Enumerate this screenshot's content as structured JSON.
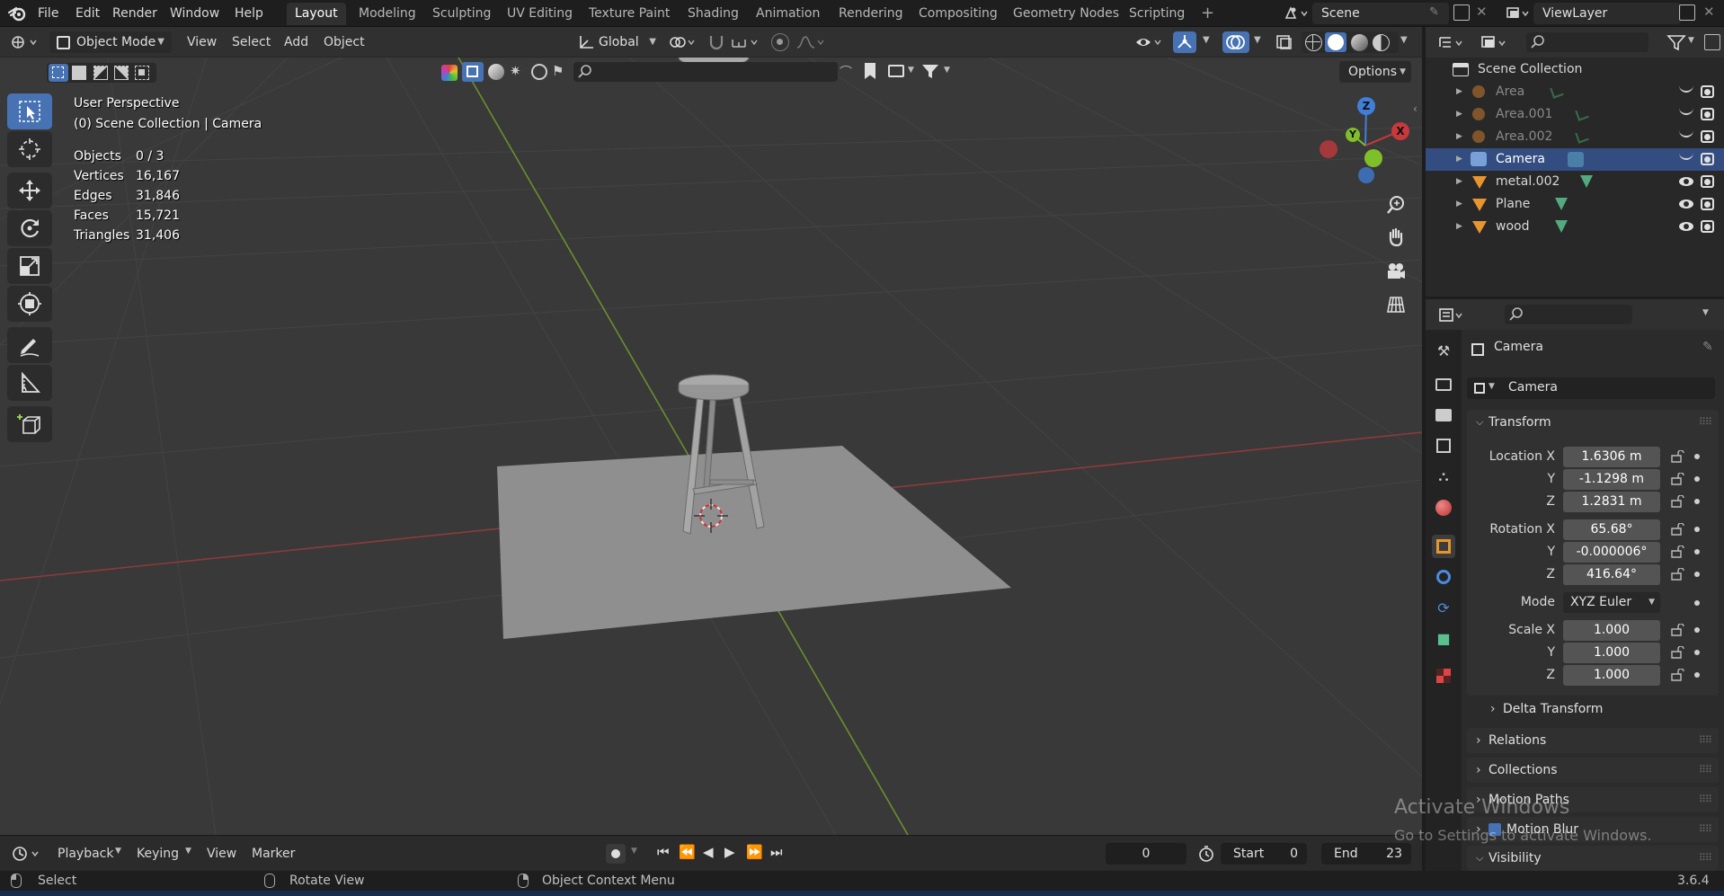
{
  "menu": {
    "file": "File",
    "edit": "Edit",
    "render": "Render",
    "window": "Window",
    "help": "Help"
  },
  "workspaces": [
    "Layout",
    "Modeling",
    "Sculpting",
    "UV Editing",
    "Texture Paint",
    "Shading",
    "Animation",
    "Rendering",
    "Compositing",
    "Geometry Nodes",
    "Scripting"
  ],
  "scene": {
    "name": "Scene",
    "view_layer": "ViewLayer"
  },
  "viewport_header": {
    "mode": "Object Mode",
    "view": "View",
    "select": "Select",
    "add": "Add",
    "object": "Object",
    "orientation": "Global",
    "options": "Options"
  },
  "overlay": {
    "perspective": "User Perspective",
    "collection": "(0) Scene Collection | Camera",
    "stats": [
      {
        "label": "Objects",
        "value": "0 / 3"
      },
      {
        "label": "Vertices",
        "value": "16,167"
      },
      {
        "label": "Edges",
        "value": "31,846"
      },
      {
        "label": "Faces",
        "value": "15,721"
      },
      {
        "label": "Triangles",
        "value": "31,406"
      }
    ]
  },
  "gizmo": {
    "z": "Z",
    "y": "Y",
    "x": "X"
  },
  "outliner": {
    "root": "Scene Collection",
    "items": [
      {
        "name": "Area",
        "type": "light",
        "selected": false,
        "visible": false
      },
      {
        "name": "Area.001",
        "type": "light",
        "selected": false,
        "visible": false
      },
      {
        "name": "Area.002",
        "type": "light",
        "selected": false,
        "visible": false
      },
      {
        "name": "Camera",
        "type": "camera",
        "selected": true,
        "visible": false
      },
      {
        "name": "metal.002",
        "type": "mesh",
        "selected": false,
        "visible": true
      },
      {
        "name": "Plane",
        "type": "mesh",
        "selected": false,
        "visible": true
      },
      {
        "name": "wood",
        "type": "mesh",
        "selected": false,
        "visible": true
      }
    ]
  },
  "properties": {
    "object_name": "Camera",
    "data_name": "Camera",
    "transform_label": "Transform",
    "location_label": "Location X",
    "location": [
      "1.6306 m",
      "-1.1298 m",
      "1.2831 m"
    ],
    "rotation_label": "Rotation X",
    "rotation": [
      "65.68°",
      "-0.000006°",
      "416.64°"
    ],
    "mode_label": "Mode",
    "mode_value": "XYZ Euler",
    "scale_label": "Scale X",
    "scale": [
      "1.000",
      "1.000",
      "1.000"
    ],
    "axis_y": "Y",
    "axis_z": "Z",
    "delta_transform": "Delta Transform",
    "relations": "Relations",
    "collections": "Collections",
    "motion_paths": "Motion Paths",
    "motion_blur": "Motion Blur",
    "visibility": "Visibility"
  },
  "timeline": {
    "playback": "Playback",
    "keying": "Keying",
    "view": "View",
    "marker": "Marker",
    "current_frame": "0",
    "start_label": "Start",
    "start": "0",
    "end_label": "End",
    "end": "23"
  },
  "statusbar": {
    "select": "Select",
    "rotate": "Rotate View",
    "context": "Object Context Menu",
    "version": "3.6.4"
  },
  "watermark": {
    "title": "Activate Windows",
    "subtitle": "Go to Settings to activate Windows."
  },
  "colors": {
    "accent": "#4772b3",
    "selected_row": "#334d80",
    "x_axis": "#c8383c",
    "y_axis": "#7fbf2a",
    "z_axis": "#3f7fd8"
  }
}
